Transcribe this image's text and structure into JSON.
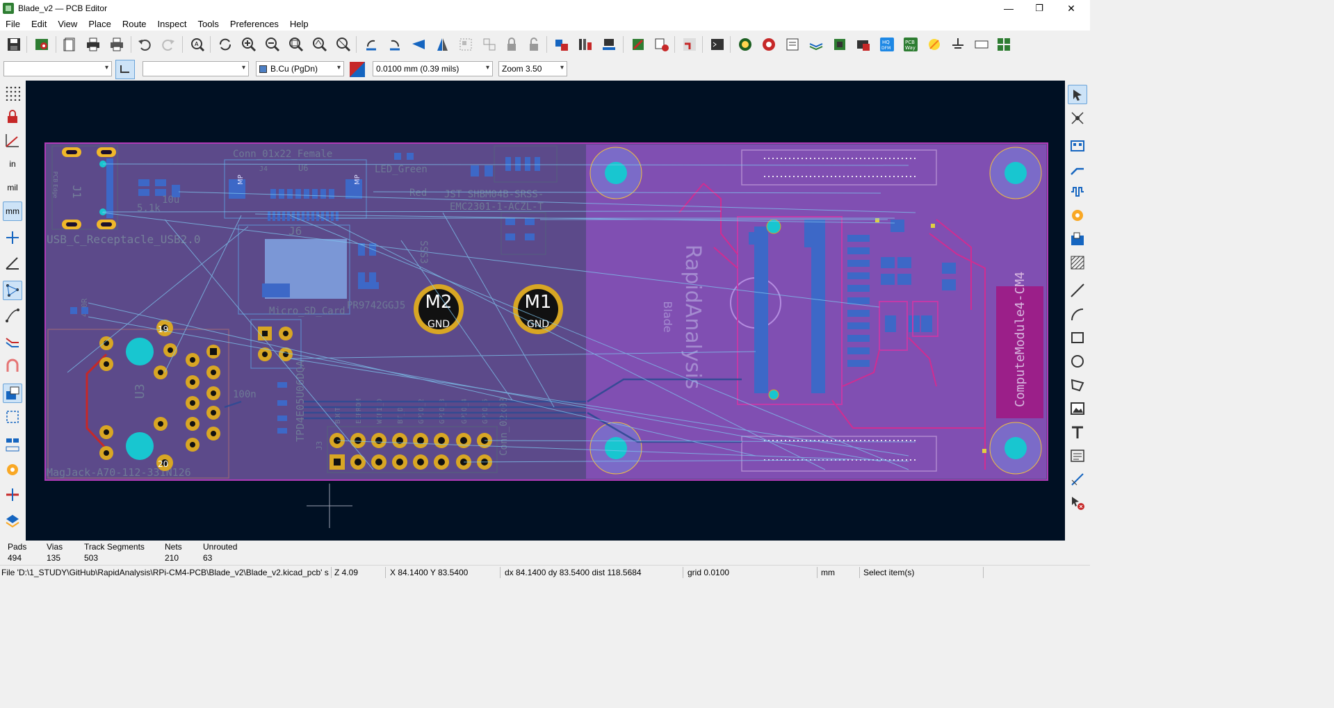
{
  "window": {
    "title": "Blade_v2 — PCB Editor",
    "controls": {
      "minimize": "—",
      "maximize": "❐",
      "close": "✕"
    }
  },
  "menu": [
    "File",
    "Edit",
    "View",
    "Place",
    "Route",
    "Inspect",
    "Tools",
    "Preferences",
    "Help"
  ],
  "toolbar2": {
    "track_width": "",
    "via_size": "",
    "layer": "B.Cu (PgDn)",
    "grid": "0.0100 mm (0.39 mils)",
    "zoom": "Zoom 3.50"
  },
  "left_toolbar": {
    "units_in": "in",
    "units_mil": "mil",
    "units_mm": "mm"
  },
  "pcb": {
    "silk_labels": {
      "usb": "USB_C_Receptacle_USB2.0",
      "pcb_edge": "PCB Edge",
      "j1": "J1",
      "conn_female": "Conn_01x22_Female",
      "j4": "J4",
      "u6": "U6",
      "led_green": "LED_Green",
      "red": "Red",
      "jst": "JST_SHBM04B-SRSS-",
      "emc": "EMC2301-1-ACZL-T",
      "j6": "J6",
      "micro_sd": "Micro_SD_Card",
      "u3": "U3",
      "magjack": "MagJack-A70-112-331N126",
      "tpd": "TPD4E05U06DQA",
      "conn_2x08": "Conn_02x08",
      "j3": "J3",
      "pin_labels": [
        "BOOT",
        "EEPROM",
        "WIFI_D",
        "BT_D",
        "GPIO_2",
        "GPIO_3",
        "GPIO_4",
        "GPIO_5"
      ],
      "compute_module": "ComputeModule4-CM4",
      "rapid_analysis": "RapidAnalysis",
      "blade": "Blade",
      "r_51k": "5.1k",
      "c_10u": "10u",
      "c_100n": "100n",
      "mp": "MP",
      "ic_pr": "PR9742GGJ5",
      "sss3": "SSS3",
      "m2": "M2",
      "m1": "M1",
      "gnd": "GND",
      "pads_top": "20",
      "pads_bot": "19",
      "r_470r": "470R"
    }
  },
  "stats": {
    "headers": [
      "Pads",
      "Vias",
      "Track Segments",
      "Nets",
      "Unrouted"
    ],
    "values": [
      "494",
      "135",
      "503",
      "210",
      "63"
    ]
  },
  "statusbar": {
    "file": "File 'D:\\1_STUDY\\GitHub\\RapidAnalysis\\RPi-CM4-PCB\\Blade_v2\\Blade_v2.kicad_pcb' s...",
    "zoom": "Z 4.09",
    "xy": "X 84.1400  Y 83.5400",
    "delta": "dx 84.1400  dy 83.5400  dist 118.5684",
    "grid": "grid 0.0100",
    "units": "mm",
    "mode": "Select item(s)"
  }
}
